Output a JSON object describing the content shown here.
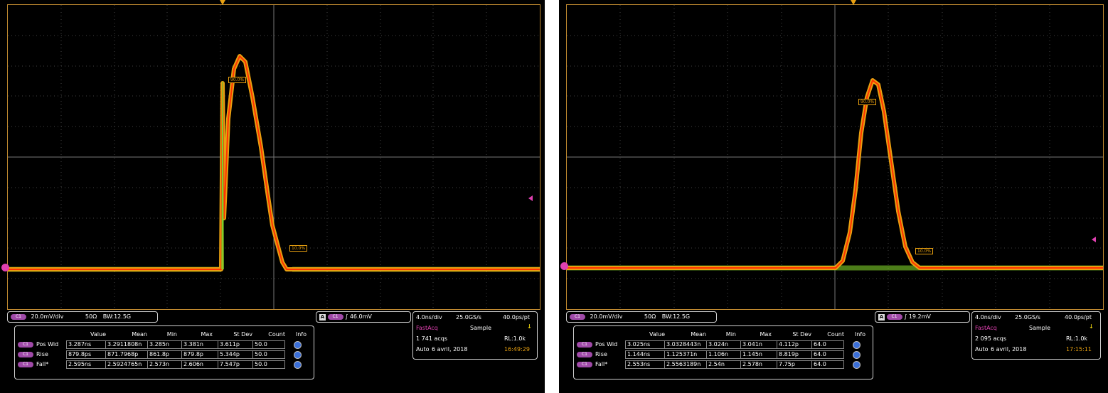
{
  "scopes": [
    {
      "channel": {
        "scale": "20.0mV/div",
        "impedance": "50Ω",
        "bandwidth": "BW:12.5G"
      },
      "trigger": {
        "source_label": "A",
        "level": "46.0mV"
      },
      "acq": {
        "timebase": "4.0ns/div",
        "sample_rate": "25.0GS/s",
        "pt": "40.0ps/pt",
        "mode": "FastAcq",
        "sample": "Sample",
        "acqs": "1 741 acqs",
        "rl": "RL:1.0k",
        "auto": "Auto",
        "date": "6 avril, 2018",
        "time": "16:49:29"
      },
      "markers": {
        "high": "90.0%",
        "low": "10.0%"
      },
      "measurements": {
        "headers": [
          "Value",
          "Mean",
          "Min",
          "Max",
          "St Dev",
          "Count",
          "Info"
        ],
        "rows": [
          {
            "name": "Pos Wid",
            "value": "3.287ns",
            "mean": "3.2911808n",
            "min": "3.285n",
            "max": "3.381n",
            "stdev": "3.611p",
            "count": "50.0"
          },
          {
            "name": "Rise",
            "value": "879.8ps",
            "mean": "871.7968p",
            "min": "861.8p",
            "max": "879.8p",
            "stdev": "5.344p",
            "count": "50.0"
          },
          {
            "name": "Fall*",
            "value": "2.595ns",
            "mean": "2.5924765n",
            "min": "2.573n",
            "max": "2.606n",
            "stdev": "7.547p",
            "count": "50.0"
          }
        ]
      }
    },
    {
      "channel": {
        "scale": "20.0mV/div",
        "impedance": "50Ω",
        "bandwidth": "BW:12.5G"
      },
      "trigger": {
        "source_label": "A",
        "level": "19.2mV"
      },
      "acq": {
        "timebase": "4.0ns/div",
        "sample_rate": "25.0GS/s",
        "pt": "40.0ps/pt",
        "mode": "FastAcq",
        "sample": "Sample",
        "acqs": "2 095 acqs",
        "rl": "RL:1.0k",
        "auto": "Auto",
        "date": "6 avril, 2018",
        "time": "17:15:11"
      },
      "markers": {
        "high": "90.0%",
        "low": "10.0%"
      },
      "measurements": {
        "headers": [
          "Value",
          "Mean",
          "Min",
          "Max",
          "St Dev",
          "Count",
          "Info"
        ],
        "rows": [
          {
            "name": "Pos Wid",
            "value": "3.025ns",
            "mean": "3.0328443n",
            "min": "3.024n",
            "max": "3.041n",
            "stdev": "4.112p",
            "count": "64.0"
          },
          {
            "name": "Rise",
            "value": "1.144ns",
            "mean": "1.125371n",
            "min": "1.106n",
            "max": "1.145n",
            "stdev": "8.819p",
            "count": "64.0"
          },
          {
            "name": "Fall*",
            "value": "2.553ns",
            "mean": "2.5563189n",
            "min": "2.54n",
            "max": "2.578n",
            "stdev": "7.75p",
            "count": "64.0"
          }
        ]
      }
    }
  ],
  "colors": {
    "trace_outer": "#e8a010",
    "trace_inner": "#ff3300",
    "noise": "#7fd02a",
    "grid": "#555555",
    "frame": "#c08a30",
    "channel_pill": "#a04aa8",
    "timestamp": "#e8a010",
    "fastacq": "#e040b0"
  }
}
